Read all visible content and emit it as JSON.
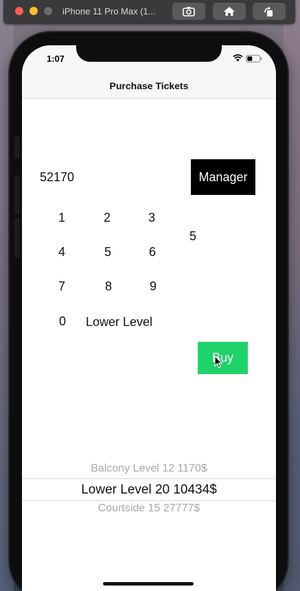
{
  "simulator": {
    "title": "iPhone 11 Pro Max (1...",
    "buttons": [
      "screenshot-icon",
      "home-icon",
      "rotate-icon"
    ]
  },
  "status_bar": {
    "time": "1:07",
    "signal": "....."
  },
  "nav": {
    "title": "Purchase Tickets"
  },
  "main": {
    "amount": "52170",
    "manager_label": "Manager",
    "keypad": [
      "1",
      "2",
      "3",
      "4",
      "5",
      "6",
      "7",
      "8",
      "9",
      "0"
    ],
    "quantity": "5",
    "level": "Lower Level",
    "buy_label": "Buy"
  },
  "picker": {
    "above": "Balcony Level 12 1170$",
    "selected": "Lower Level 20 10434$",
    "below": "Courtside 15 27777$"
  },
  "colors": {
    "buy_button": "#1fd26a",
    "manager_button": "#000000"
  }
}
